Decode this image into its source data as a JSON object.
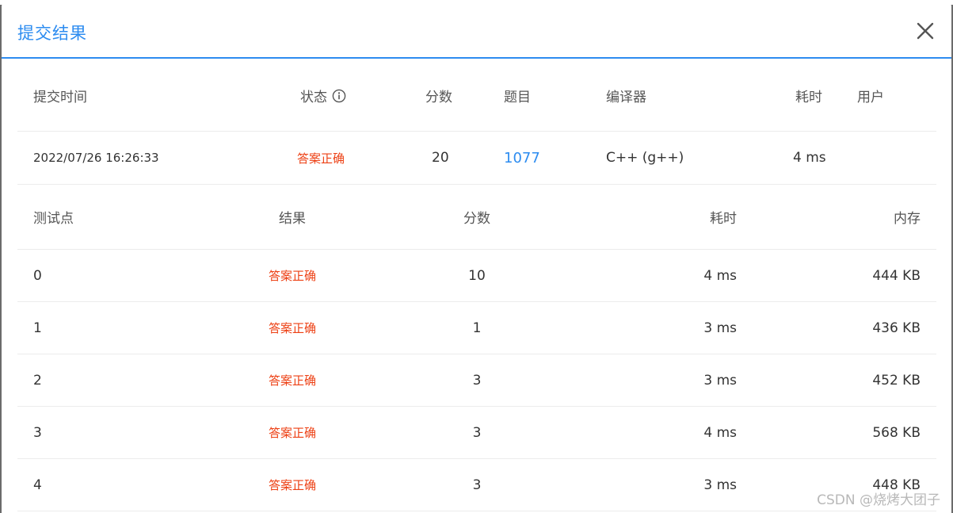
{
  "dialog": {
    "title": "提交结果"
  },
  "summary": {
    "headers": {
      "time": "提交时间",
      "status": "状态",
      "score": "分数",
      "problem": "题目",
      "compiler": "编译器",
      "cost": "耗时",
      "user": "用户"
    },
    "row": {
      "time": "2022/07/26 16:26:33",
      "status": "答案正确",
      "score": "20",
      "problem": "1077",
      "compiler": "C++ (g++)",
      "cost": "4 ms",
      "user": ""
    }
  },
  "testcases": {
    "headers": {
      "id": "测试点",
      "result": "结果",
      "score": "分数",
      "time": "耗时",
      "memory": "内存"
    },
    "rows": [
      {
        "id": "0",
        "result": "答案正确",
        "score": "10",
        "time": "4 ms",
        "memory": "444 KB"
      },
      {
        "id": "1",
        "result": "答案正确",
        "score": "1",
        "time": "3 ms",
        "memory": "436 KB"
      },
      {
        "id": "2",
        "result": "答案正确",
        "score": "3",
        "time": "3 ms",
        "memory": "452 KB"
      },
      {
        "id": "3",
        "result": "答案正确",
        "score": "3",
        "time": "4 ms",
        "memory": "568 KB"
      },
      {
        "id": "4",
        "result": "答案正确",
        "score": "3",
        "time": "3 ms",
        "memory": "448 KB"
      }
    ]
  },
  "watermark": "CSDN @烧烤大团子",
  "colors": {
    "accent": "#2d8cf0",
    "status_ok": "#ed4014"
  }
}
